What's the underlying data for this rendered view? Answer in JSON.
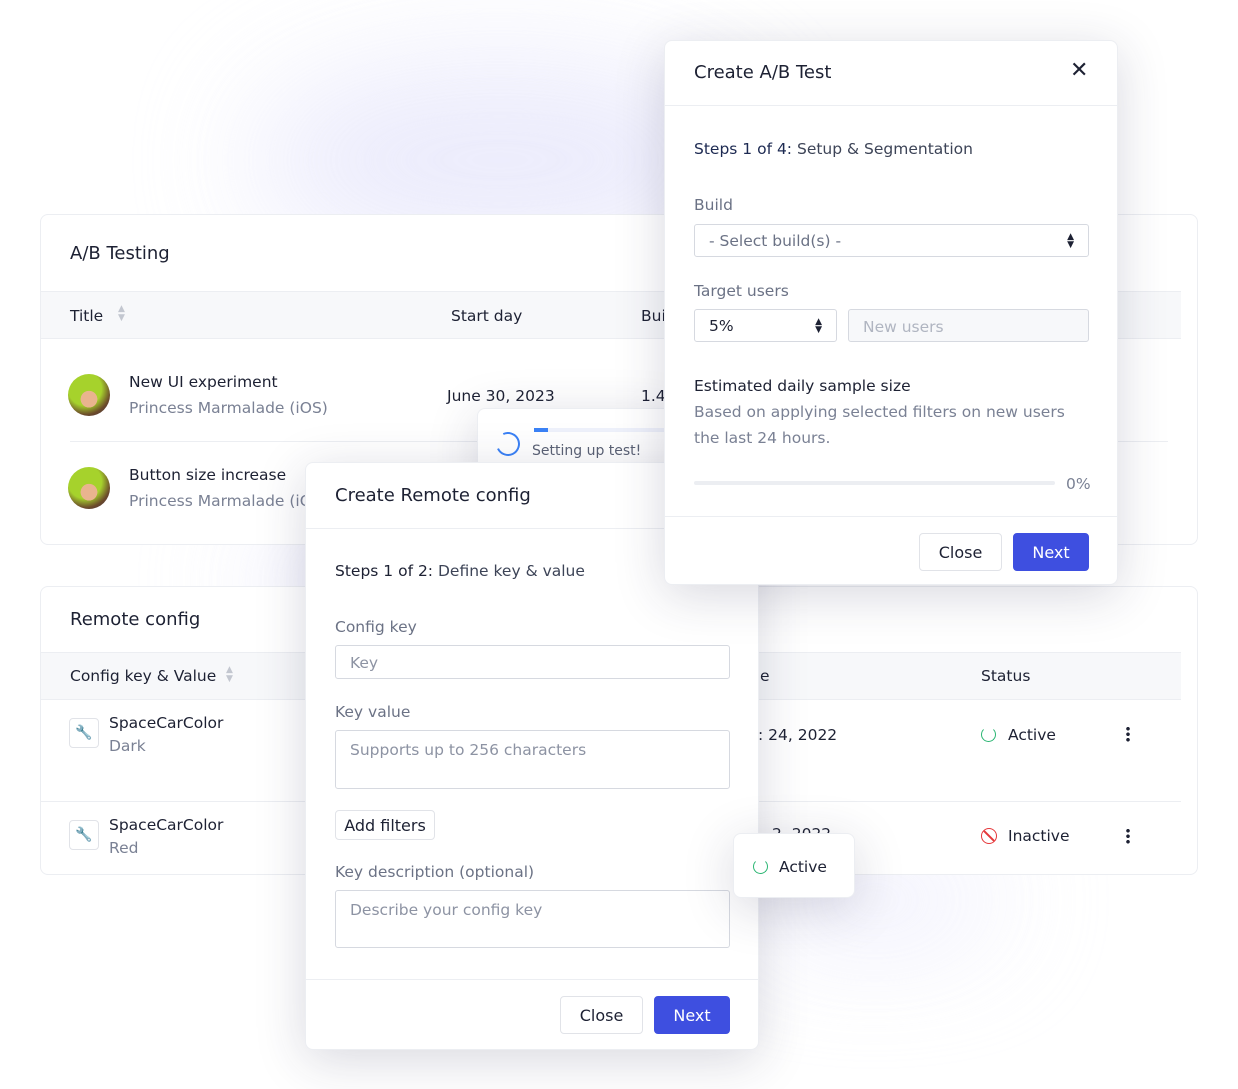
{
  "colors": {
    "accent": "#3e4fe0",
    "active": "#2bb673",
    "inactive": "#e5383b",
    "spinner": "#3b82f6"
  },
  "ab_card": {
    "title": "A/B Testing",
    "columns": [
      "Title",
      "Start day",
      "Bui"
    ],
    "rows": [
      {
        "title": "New UI experiment",
        "subtitle": "Princess Marmalade (iOS)",
        "start": "June 30, 2023",
        "build": "1.4"
      },
      {
        "title": "Button size increase",
        "subtitle": "Princess Marmalade (iOS)"
      }
    ]
  },
  "toast": {
    "text": "Setting up test!"
  },
  "remote_card": {
    "title": "Remote config",
    "columns": [
      "Config key & Value",
      "e",
      "Status"
    ],
    "rows": [
      {
        "key": "SpaceCarColor",
        "value": "Dark",
        "date": ": 24, 2022",
        "status": "Active"
      },
      {
        "key": "SpaceCarColor",
        "value": "Red",
        "date": "2, 2022",
        "status": "Inactive"
      }
    ]
  },
  "ab_modal": {
    "title": "Create A/B Test",
    "steps_prefix": "Steps 1 of 4:",
    "steps_name": "Setup & Segmentation",
    "build_label": "Build",
    "build_select": "- Select build(s) -",
    "target_label": "Target users",
    "target_select": "5%",
    "target_input_placeholder": "New users",
    "estimate_title": "Estimated daily sample size",
    "estimate_desc_1": "Based on applying selected filters on new users",
    "estimate_desc_2": "the last 24 hours.",
    "progress_percent": 0,
    "progress_label": "0%",
    "close": "Close",
    "next": "Next"
  },
  "remote_modal": {
    "title": "Create Remote config",
    "steps_prefix": "Steps 1 of 2:",
    "steps_name": "Define key & value",
    "key_label": "Config key",
    "key_placeholder": "Key",
    "value_label": "Key value",
    "value_placeholder": "Supports up to 256 characters",
    "add_filters": "Add filters",
    "desc_label": "Key description (optional)",
    "desc_placeholder": "Describe your config key",
    "close": "Close",
    "next": "Next"
  },
  "chip": {
    "status": "Active"
  }
}
